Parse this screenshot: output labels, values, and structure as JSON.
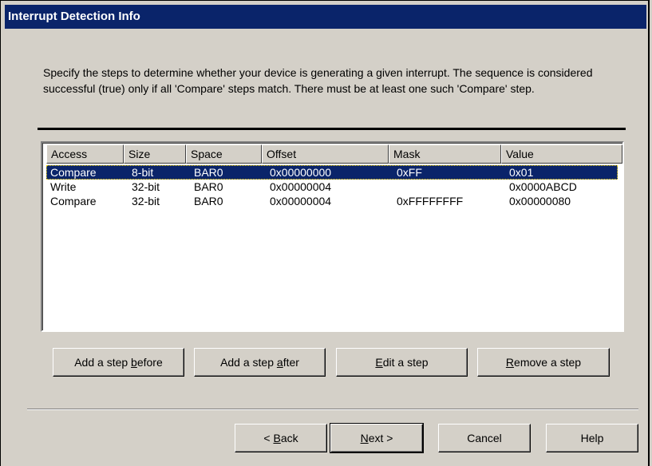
{
  "title": "Interrupt Detection Info",
  "description": "Specify the steps to determine whether your device is generating a given interrupt.  The sequence is considered successful (true) only if all 'Compare' steps match.  There must be at least one such 'Compare' step.",
  "table": {
    "columns": [
      "Access",
      "Size",
      "Space",
      "Offset",
      "Mask",
      "Value"
    ],
    "rows": [
      {
        "access": "Compare",
        "size": "8-bit",
        "space": "BAR0",
        "offset": "0x00000000",
        "mask": "0xFF",
        "value": "0x01",
        "selected": true
      },
      {
        "access": "Write",
        "size": "32-bit",
        "space": "BAR0",
        "offset": "0x00000004",
        "mask": "",
        "value": "0x0000ABCD",
        "selected": false
      },
      {
        "access": "Compare",
        "size": "32-bit",
        "space": "BAR0",
        "offset": "0x00000004",
        "mask": "0xFFFFFFFF",
        "value": "0x00000080",
        "selected": false
      }
    ]
  },
  "step_buttons": {
    "add_before": {
      "pre": "Add a step ",
      "key": "b",
      "post": "efore"
    },
    "add_after": {
      "pre": "Add a step ",
      "key": "a",
      "post": "fter"
    },
    "edit": {
      "pre": "",
      "key": "E",
      "post": "dit a step"
    },
    "remove": {
      "pre": "",
      "key": "R",
      "post": "emove a step"
    }
  },
  "nav_buttons": {
    "back": {
      "pre": "< ",
      "key": "B",
      "post": "ack"
    },
    "next": {
      "pre": "",
      "key": "N",
      "post": "ext >"
    },
    "cancel": "Cancel",
    "help": "Help"
  },
  "colors": {
    "face": "#d4d0c8",
    "titlebar": "#0a246a",
    "selection": "#0a246a"
  }
}
